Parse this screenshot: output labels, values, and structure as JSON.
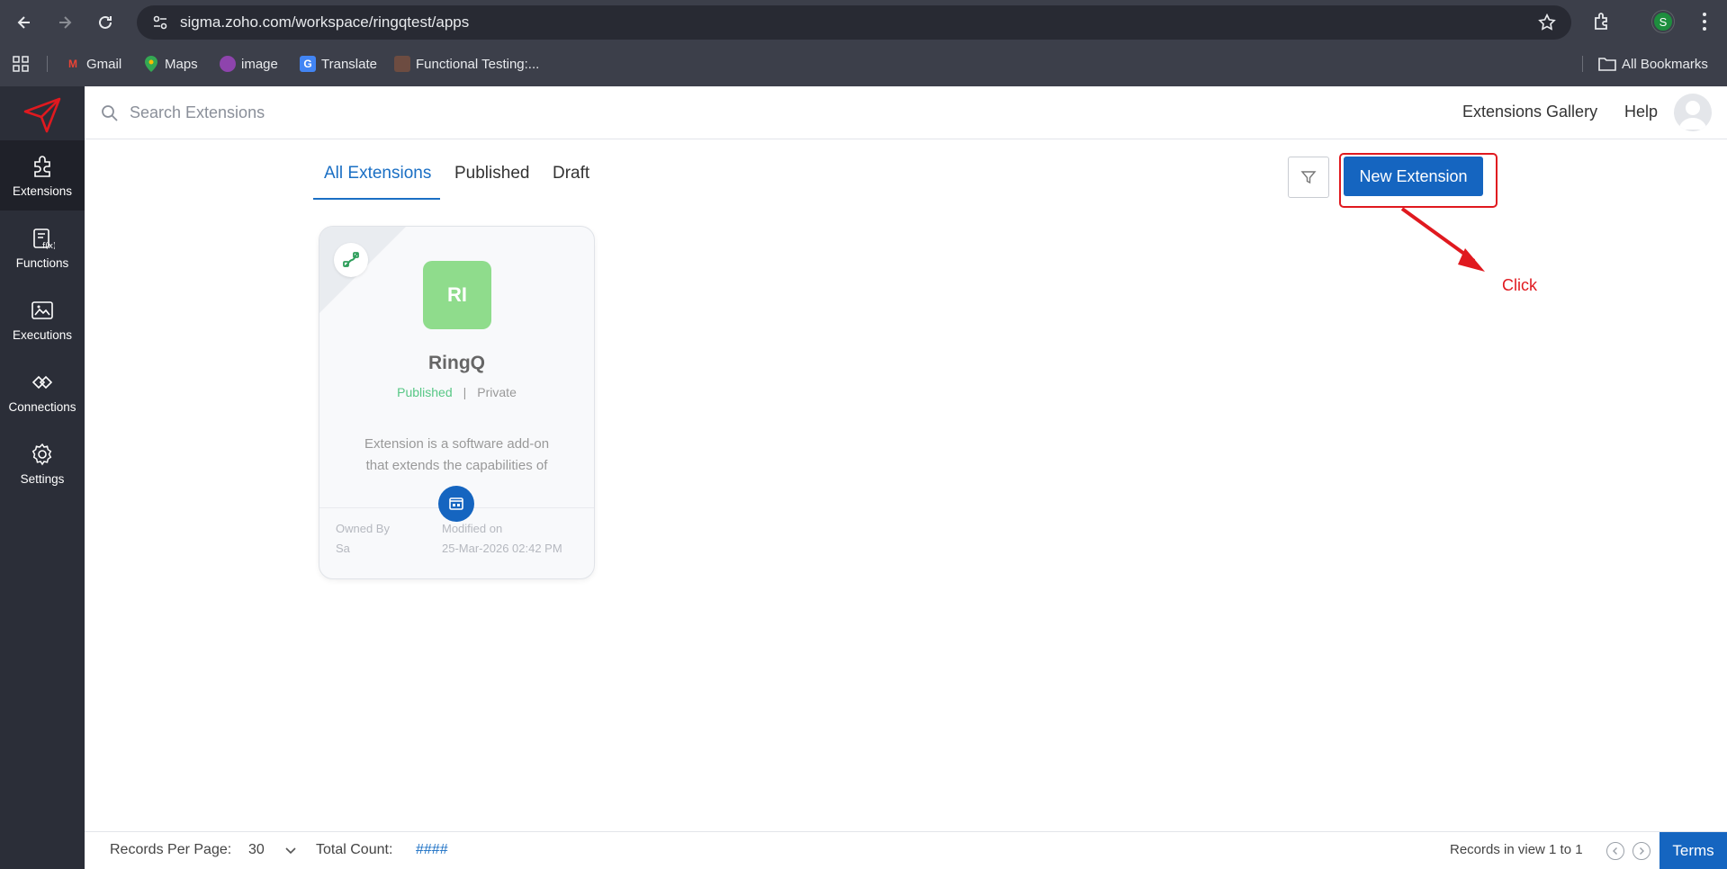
{
  "browser": {
    "url": "sigma.zoho.com/workspace/ringqtest/apps",
    "profile_initial": "S",
    "bookmarks": [
      {
        "label": "Gmail"
      },
      {
        "label": "Maps"
      },
      {
        "label": "image"
      },
      {
        "label": "Translate"
      },
      {
        "label": "Functional Testing:..."
      }
    ],
    "all_bookmarks": "All Bookmarks"
  },
  "sidebar": {
    "items": [
      {
        "label": "Extensions",
        "icon": "puzzle-icon"
      },
      {
        "label": "Functions",
        "icon": "function-icon"
      },
      {
        "label": "Executions",
        "icon": "executions-icon"
      },
      {
        "label": "Connections",
        "icon": "connections-icon"
      },
      {
        "label": "Settings",
        "icon": "gear-icon"
      }
    ]
  },
  "header": {
    "search_placeholder": "Search Extensions",
    "gallery_label": "Extensions Gallery",
    "help_label": "Help"
  },
  "tabs": [
    {
      "label": "All Extensions",
      "active": true
    },
    {
      "label": "Published"
    },
    {
      "label": "Draft"
    }
  ],
  "toolbar": {
    "new_extension_label": "New Extension"
  },
  "annotation": {
    "label": "Click",
    "color": "#e0191f"
  },
  "card": {
    "initials": "RI",
    "title": "RingQ",
    "status": "Published",
    "visibility": "Private",
    "description": "Extension is a software add-on that extends the capabilities of",
    "owned_by_label": "Owned By",
    "owned_by_value": "Sa",
    "modified_label": "Modified on",
    "modified_value": "25-Mar-2026 02:42 PM"
  },
  "footer": {
    "records_per_page_label": "Records Per Page:",
    "records_per_page_value": "30",
    "total_count_label": "Total Count:",
    "total_count_value": "####",
    "records_in_view": "Records in view 1 to 1",
    "terms_label": "Terms"
  },
  "colors": {
    "accent": "#1565c0",
    "sidebar_bg": "#2b2e38",
    "published": "#57c785",
    "initials_bg": "#8fdc8c"
  }
}
